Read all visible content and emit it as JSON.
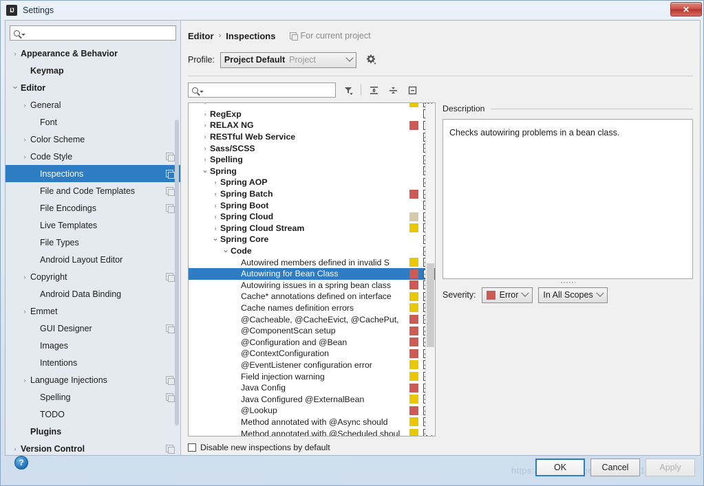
{
  "window": {
    "title": "Settings",
    "app_icon": "intellij-idea-icon",
    "close_label": "✕"
  },
  "sidebar": {
    "search": {
      "placeholder": "",
      "value": "",
      "icon": "search-icon"
    },
    "items": [
      {
        "label": "Appearance & Behavior",
        "arrow": "›",
        "bold": true,
        "indent": 0,
        "copy": false,
        "selected": false
      },
      {
        "label": "Keymap",
        "arrow": "",
        "bold": true,
        "indent": 1,
        "copy": false,
        "selected": false
      },
      {
        "label": "Editor",
        "arrow": "⌄",
        "bold": true,
        "indent": 0,
        "copy": false,
        "selected": false
      },
      {
        "label": "General",
        "arrow": "›",
        "bold": false,
        "indent": 1,
        "copy": false,
        "selected": false
      },
      {
        "label": "Font",
        "arrow": "",
        "bold": false,
        "indent": 2,
        "copy": false,
        "selected": false
      },
      {
        "label": "Color Scheme",
        "arrow": "›",
        "bold": false,
        "indent": 1,
        "copy": false,
        "selected": false
      },
      {
        "label": "Code Style",
        "arrow": "›",
        "bold": false,
        "indent": 1,
        "copy": true,
        "selected": false
      },
      {
        "label": "Inspections",
        "arrow": "",
        "bold": false,
        "indent": 2,
        "copy": true,
        "selected": true
      },
      {
        "label": "File and Code Templates",
        "arrow": "",
        "bold": false,
        "indent": 2,
        "copy": true,
        "selected": false
      },
      {
        "label": "File Encodings",
        "arrow": "",
        "bold": false,
        "indent": 2,
        "copy": true,
        "selected": false
      },
      {
        "label": "Live Templates",
        "arrow": "",
        "bold": false,
        "indent": 2,
        "copy": false,
        "selected": false
      },
      {
        "label": "File Types",
        "arrow": "",
        "bold": false,
        "indent": 2,
        "copy": false,
        "selected": false
      },
      {
        "label": "Android Layout Editor",
        "arrow": "",
        "bold": false,
        "indent": 2,
        "copy": false,
        "selected": false
      },
      {
        "label": "Copyright",
        "arrow": "›",
        "bold": false,
        "indent": 1,
        "copy": true,
        "selected": false
      },
      {
        "label": "Android Data Binding",
        "arrow": "",
        "bold": false,
        "indent": 2,
        "copy": false,
        "selected": false
      },
      {
        "label": "Emmet",
        "arrow": "›",
        "bold": false,
        "indent": 1,
        "copy": false,
        "selected": false
      },
      {
        "label": "GUI Designer",
        "arrow": "",
        "bold": false,
        "indent": 2,
        "copy": true,
        "selected": false
      },
      {
        "label": "Images",
        "arrow": "",
        "bold": false,
        "indent": 2,
        "copy": false,
        "selected": false
      },
      {
        "label": "Intentions",
        "arrow": "",
        "bold": false,
        "indent": 2,
        "copy": false,
        "selected": false
      },
      {
        "label": "Language Injections",
        "arrow": "›",
        "bold": false,
        "indent": 1,
        "copy": true,
        "selected": false
      },
      {
        "label": "Spelling",
        "arrow": "",
        "bold": false,
        "indent": 2,
        "copy": true,
        "selected": false
      },
      {
        "label": "TODO",
        "arrow": "",
        "bold": false,
        "indent": 2,
        "copy": false,
        "selected": false
      },
      {
        "label": "Plugins",
        "arrow": "",
        "bold": true,
        "indent": 1,
        "copy": false,
        "selected": false
      },
      {
        "label": "Version Control",
        "arrow": "›",
        "bold": true,
        "indent": 0,
        "copy": true,
        "selected": false
      }
    ]
  },
  "breadcrumb": {
    "parent": "Editor",
    "separator": "›",
    "current": "Inspections",
    "note": "For current project",
    "note_icon": "copy-icon"
  },
  "profile": {
    "label": "Profile:",
    "value": "Project Default",
    "scope": "Project",
    "gear_icon": "gear-icon"
  },
  "tree_toolbar": {
    "search": {
      "placeholder": "",
      "value": "",
      "icon": "search-icon"
    },
    "buttons": [
      {
        "name": "filter-icon",
        "title": "Filter"
      },
      {
        "name": "expand-all-icon",
        "title": "Expand All"
      },
      {
        "name": "collapse-all-icon",
        "title": "Collapse All"
      },
      {
        "name": "show-only-changed-icon",
        "title": "Show Only Modified"
      }
    ]
  },
  "tree": {
    "rows": [
      {
        "label": "",
        "indent": 1,
        "arrow": "›",
        "bold": true,
        "swatch": "#E8C800",
        "check": "checked",
        "selected": false,
        "partial_top": true
      },
      {
        "label": "RegExp",
        "indent": 1,
        "arrow": "›",
        "bold": true,
        "swatch": "",
        "check": "partial",
        "selected": false
      },
      {
        "label": "RELAX NG",
        "indent": 1,
        "arrow": "›",
        "bold": true,
        "swatch": "#CC5B55",
        "check": "partial",
        "selected": false
      },
      {
        "label": "RESTful Web Service",
        "indent": 1,
        "arrow": "›",
        "bold": true,
        "swatch": "",
        "check": "checked",
        "selected": false
      },
      {
        "label": "Sass/SCSS",
        "indent": 1,
        "arrow": "›",
        "bold": true,
        "swatch": "",
        "check": "checked",
        "selected": false
      },
      {
        "label": "Spelling",
        "indent": 1,
        "arrow": "›",
        "bold": true,
        "swatch": "",
        "check": "checked",
        "selected": false
      },
      {
        "label": "Spring",
        "indent": 1,
        "arrow": "⌄",
        "bold": true,
        "swatch": "",
        "check": "checked",
        "selected": false
      },
      {
        "label": "Spring AOP",
        "indent": 2,
        "arrow": "›",
        "bold": true,
        "swatch": "",
        "check": "checked",
        "selected": false
      },
      {
        "label": "Spring Batch",
        "indent": 2,
        "arrow": "›",
        "bold": true,
        "swatch": "#CC5B55",
        "check": "checked",
        "selected": false
      },
      {
        "label": "Spring Boot",
        "indent": 2,
        "arrow": "›",
        "bold": true,
        "swatch": "",
        "check": "checked",
        "selected": false
      },
      {
        "label": "Spring Cloud",
        "indent": 2,
        "arrow": "›",
        "bold": true,
        "swatch": "#D6C9A9",
        "check": "checked",
        "selected": false
      },
      {
        "label": "Spring Cloud Stream",
        "indent": 2,
        "arrow": "›",
        "bold": true,
        "swatch": "#E8C800",
        "check": "checked",
        "selected": false
      },
      {
        "label": "Spring Core",
        "indent": 2,
        "arrow": "⌄",
        "bold": true,
        "swatch": "",
        "check": "checked",
        "selected": false
      },
      {
        "label": "Code",
        "indent": 3,
        "arrow": "⌄",
        "bold": true,
        "swatch": "",
        "check": "checked",
        "selected": false
      },
      {
        "label": "Autowired members defined in invalid S",
        "indent": 4,
        "arrow": "",
        "bold": false,
        "swatch": "#E8C800",
        "check": "checked",
        "selected": false
      },
      {
        "label": "Autowiring for Bean Class",
        "indent": 4,
        "arrow": "",
        "bold": false,
        "swatch": "#CC5B55",
        "check": "checked",
        "selected": true
      },
      {
        "label": "Autowiring issues in a spring bean class",
        "indent": 4,
        "arrow": "",
        "bold": false,
        "swatch": "#CC5B55",
        "check": "checked",
        "selected": false
      },
      {
        "label": "Cache* annotations defined on interface",
        "indent": 4,
        "arrow": "",
        "bold": false,
        "swatch": "#E8C800",
        "check": "checked",
        "selected": false
      },
      {
        "label": "Cache names definition errors",
        "indent": 4,
        "arrow": "",
        "bold": false,
        "swatch": "#E8C800",
        "check": "checked",
        "selected": false
      },
      {
        "label": "@Cacheable, @CacheEvict, @CachePut, ",
        "indent": 4,
        "arrow": "",
        "bold": false,
        "swatch": "#CC5B55",
        "check": "checked",
        "selected": false
      },
      {
        "label": "@ComponentScan setup",
        "indent": 4,
        "arrow": "",
        "bold": false,
        "swatch": "#CC5B55",
        "check": "checked",
        "selected": false
      },
      {
        "label": "@Configuration and @Bean",
        "indent": 4,
        "arrow": "",
        "bold": false,
        "swatch": "#CC5B55",
        "check": "checked",
        "selected": false
      },
      {
        "label": "@ContextConfiguration",
        "indent": 4,
        "arrow": "",
        "bold": false,
        "swatch": "#CC5B55",
        "check": "checked",
        "selected": false
      },
      {
        "label": "@EventListener configuration error",
        "indent": 4,
        "arrow": "",
        "bold": false,
        "swatch": "#E8C800",
        "check": "checked",
        "selected": false
      },
      {
        "label": "Field injection warning",
        "indent": 4,
        "arrow": "",
        "bold": false,
        "swatch": "#E8C800",
        "check": "checked",
        "selected": false
      },
      {
        "label": "Java Config",
        "indent": 4,
        "arrow": "",
        "bold": false,
        "swatch": "#CC5B55",
        "check": "checked",
        "selected": false
      },
      {
        "label": "Java Configured @ExternalBean",
        "indent": 4,
        "arrow": "",
        "bold": false,
        "swatch": "#E8C800",
        "check": "checked",
        "selected": false
      },
      {
        "label": "@Lookup",
        "indent": 4,
        "arrow": "",
        "bold": false,
        "swatch": "#CC5B55",
        "check": "checked",
        "selected": false
      },
      {
        "label": "Method annotated with @Async should",
        "indent": 4,
        "arrow": "",
        "bold": false,
        "swatch": "#E8C800",
        "check": "checked",
        "selected": false
      },
      {
        "label": "Method annotated with @Scheduled shoul",
        "indent": 4,
        "arrow": "",
        "bold": false,
        "swatch": "#E8C800",
        "check": "checked",
        "selected": false
      }
    ],
    "disable_new": {
      "label": "Disable new inspections by default",
      "checked": false
    }
  },
  "description": {
    "header": "Description",
    "text": "Checks autowiring problems in a bean class."
  },
  "severity": {
    "label": "Severity:",
    "value": "Error",
    "color": "#CC5B55",
    "scope": "In All Scopes"
  },
  "footer": {
    "help": "?",
    "ok": "OK",
    "cancel": "Cancel",
    "apply": "Apply",
    "watermark": "https://blog.csdn.net/weixin_44162998"
  }
}
